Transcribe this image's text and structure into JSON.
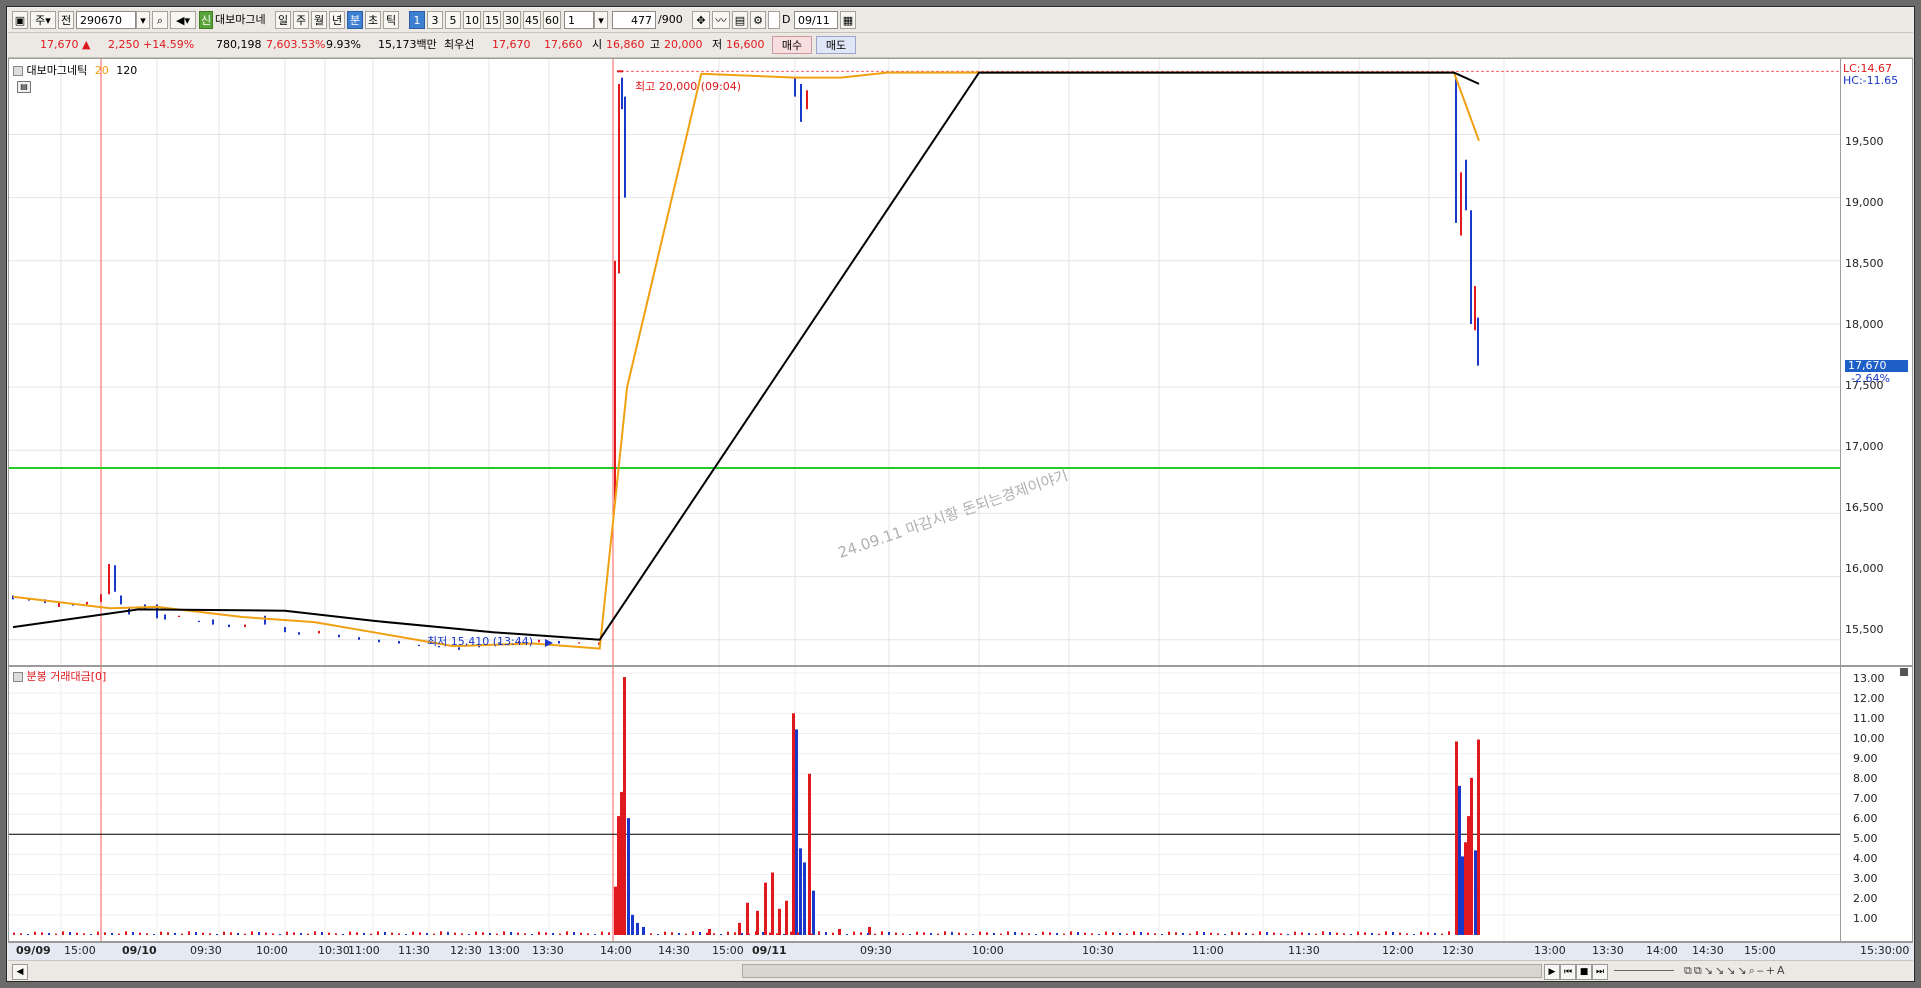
{
  "toolbar": {
    "period_label": "주",
    "jeon_label": "전",
    "code": "290670",
    "sin_badge": "신",
    "stock_name": "대보마그네",
    "tf_day": "일",
    "tf_week": "주",
    "tf_month": "월",
    "tf_year": "년",
    "tf_min": "분",
    "tf_sec": "초",
    "tf_tick": "틱",
    "intervals": [
      "1",
      "3",
      "5",
      "10",
      "15",
      "30",
      "45",
      "60"
    ],
    "interval_select": "1",
    "count_value": "477",
    "count_total": "/900",
    "d_label": "D",
    "date_value": "09/11"
  },
  "quote": {
    "price": "17,670",
    "change_arrow": "▲",
    "change": "2,250",
    "change_pct": "+14.59%",
    "volume": "780,198",
    "volume_pct": "7,603.53%",
    "turnover_pct": "9.93%",
    "amount": "15,173백만",
    "pref_label": "최우선",
    "ask": "17,670",
    "bid": "17,660",
    "open_label": "시",
    "open": "16,860",
    "high_label": "고",
    "high": "20,000",
    "low_label": "저",
    "low": "16,600",
    "buy_label": "매수",
    "sell_label": "매도"
  },
  "price_panel": {
    "title": "대보마그네틱",
    "ma1": "20",
    "ma2": "120",
    "lc": "LC:14.67",
    "hc": "HC:-11.65",
    "high_annotation": "최고 20,000 (09:04)",
    "low_annotation": "최저 15,410 (13:44)",
    "watermark": "24.09.11 마감시황 돈되는경제이야기",
    "current_price_tag": "17,670",
    "current_pct_tag": "-2.64%",
    "y_ticks": [
      "19,500",
      "19,000",
      "18,500",
      "18,000",
      "17,500",
      "17,000",
      "16,500",
      "16,000",
      "15,500"
    ]
  },
  "volume_panel": {
    "title": "분봉 거래대금[0]",
    "y_ticks": [
      "13.00",
      "12.00",
      "11.00",
      "10.00",
      "9.00",
      "8.00",
      "7.00",
      "6.00",
      "5.00",
      "4.00",
      "3.00",
      "2.00",
      "1.00"
    ]
  },
  "x_axis": {
    "labels": [
      "09/09",
      "15:00",
      "09/10",
      "09:30",
      "10:00",
      "10:30",
      "11:00",
      "11:30",
      "12:30",
      "13:00",
      "13:30",
      "14:00",
      "14:30",
      "15:00",
      "09/11",
      "09:30",
      "10:00",
      "10:30",
      "11:00",
      "11:30",
      "12:00",
      "12:30",
      "13:00",
      "13:30",
      "14:00",
      "14:30",
      "15:00",
      "15:30:00"
    ]
  },
  "colors": {
    "up": "#e0191f",
    "down": "#1937c8",
    "ma20": "#f0a010",
    "ma120": "#000000",
    "hline": "#22cc22"
  },
  "chart_data": {
    "type": "line",
    "title": "대보마그네틱",
    "series": [
      {
        "name": "20",
        "x": [
          "09/09 14:10",
          "09/10 09:05",
          "09/10 09:30",
          "09/10 10:30",
          "09/10 11:30",
          "09/10 12:30",
          "09/10 13:30",
          "09/10 14:30",
          "09/10 15:20",
          "09/11 09:04",
          "09/11 09:25",
          "09/11 10:00",
          "09/11 10:15",
          "09/11 10:30",
          "09/11 15:10",
          "09/11 15:20"
        ],
        "values": [
          15840,
          15750,
          15760,
          15680,
          15640,
          15560,
          15450,
          15470,
          15430,
          17500,
          19980,
          19950,
          19950,
          19990,
          19990,
          19450
        ]
      },
      {
        "name": "120",
        "x": [
          "09/09 14:10",
          "09/10 09:20",
          "09/10 11:00",
          "09/10 12:30",
          "09/10 14:00",
          "09/10 15:20",
          "09/11 11:00",
          "09/11 15:10",
          "09/11 15:20"
        ],
        "values": [
          15600,
          15740,
          15730,
          15650,
          15560,
          15500,
          19990,
          19990,
          19900
        ]
      }
    ],
    "ylim": [
      15300,
      20050
    ],
    "annotations": [
      "최고 20,000 (09:04)",
      "최저 15,410 (13:44)"
    ],
    "volume": {
      "ylim": [
        0,
        13
      ],
      "notable_bars": [
        {
          "x": "09/11 09:01",
          "value": 12.8
        },
        {
          "x": "09/11 10:00",
          "value": 11.0
        },
        {
          "x": "09/11 15:19",
          "value": 9.7
        },
        {
          "x": "09/11 15:14",
          "value": 9.6
        }
      ]
    }
  }
}
